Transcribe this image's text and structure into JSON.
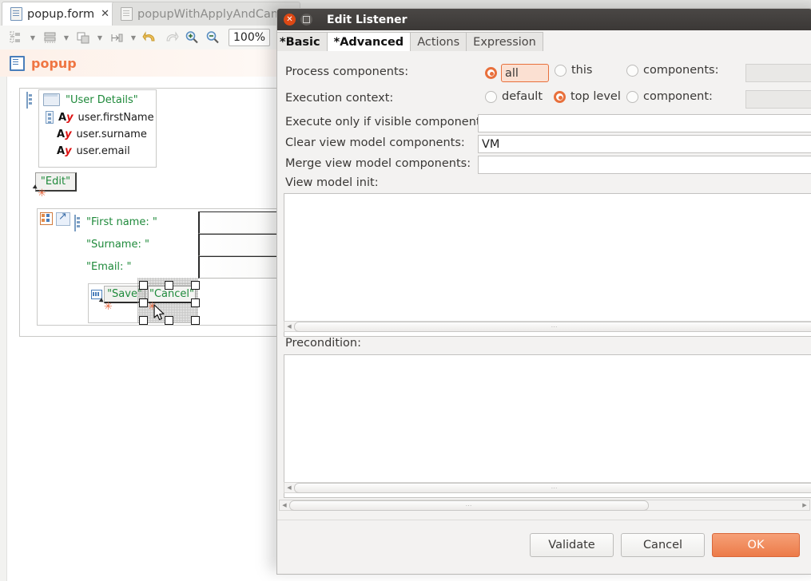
{
  "editor": {
    "tabs": [
      {
        "label": "popup.form",
        "active": true,
        "close": "✕"
      },
      {
        "label": "popupWithApplyAndCance",
        "active": false
      }
    ],
    "toolbar": {
      "zoom_value": "100%",
      "icons": [
        "align-left-icon",
        "align-center-icon",
        "overlap-icon",
        "distribute-icon",
        "undo-icon",
        "redo-icon",
        "zoom-in-icon",
        "zoom-out-icon"
      ]
    },
    "form_header": {
      "title": "popup",
      "icon": "form-icon"
    },
    "tree": {
      "panel_title": "\"User Details\"",
      "fields": [
        {
          "label": "user.firstName"
        },
        {
          "label": "user.surname"
        },
        {
          "label": "user.email"
        }
      ],
      "edit_button": "\"Edit\""
    },
    "form": {
      "rows": [
        {
          "label": "\"First name: \""
        },
        {
          "label": "\"Surname: \""
        },
        {
          "label": "\"Email: \""
        }
      ],
      "save_button": "\"Save\"",
      "cancel_button": "\"Cancel\""
    }
  },
  "dialog": {
    "title": "Edit Listener",
    "window_buttons": {
      "close": "✕",
      "maximize": "maximize-icon"
    },
    "tabs": [
      {
        "label": "*Basic",
        "selected": false
      },
      {
        "label": "*Advanced",
        "selected": true
      },
      {
        "label": "Actions",
        "selected": false
      },
      {
        "label": "Expression",
        "selected": false
      }
    ],
    "fields": {
      "process_components": {
        "label": "Process components:",
        "options": [
          {
            "label": "all",
            "selected": true,
            "type": "text-radio",
            "value": "all"
          },
          {
            "label": "this",
            "selected": false
          },
          {
            "label": "components:",
            "selected": false
          }
        ],
        "components_value": ""
      },
      "execution_context": {
        "label": "Execution context:",
        "options": [
          {
            "label": "default",
            "selected": false
          },
          {
            "label": "top level",
            "selected": true
          },
          {
            "label": "component:",
            "selected": false
          }
        ],
        "component_value": ""
      },
      "execute_only_if_visible": {
        "label": "Execute only if visible components:",
        "value": ""
      },
      "clear_view_model": {
        "label": "Clear view model components:",
        "value": "VM"
      },
      "merge_view_model": {
        "label": "Merge view model components:",
        "value": ""
      },
      "view_model_init": {
        "label": "View model init:",
        "value": ""
      },
      "precondition": {
        "label": "Precondition:",
        "value": ""
      }
    },
    "buttons": {
      "validate": "Validate",
      "cancel": "Cancel",
      "ok": "OK"
    }
  },
  "colors": {
    "accent_orange": "#e8703c",
    "primary_button": "#ec7b49",
    "green_text": "#1f8a3b",
    "title_bar": "#3b3836"
  }
}
